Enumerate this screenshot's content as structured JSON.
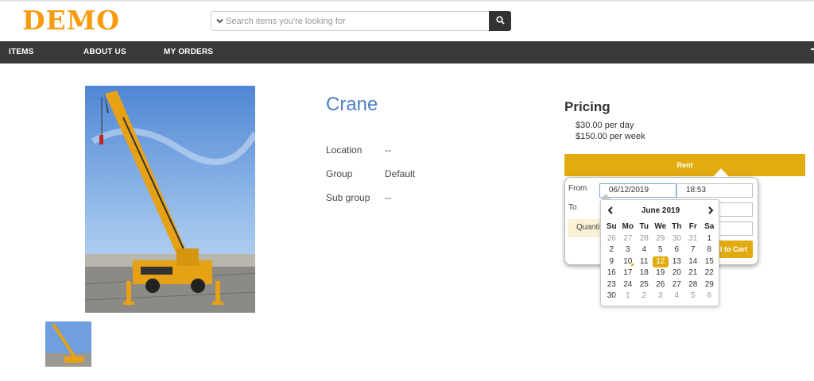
{
  "header": {
    "logo": "DEMO",
    "search_placeholder": "Search items you're looking for",
    "search_icon": "search-icon"
  },
  "nav": {
    "items": [
      {
        "label": "ITEMS"
      },
      {
        "label": "ABOUT US"
      },
      {
        "label": "MY ORDERS"
      }
    ]
  },
  "product": {
    "title": "Crane",
    "details": [
      {
        "label": "Location",
        "value": "--"
      },
      {
        "label": "Group",
        "value": "Default"
      },
      {
        "label": "Sub group",
        "value": "--"
      }
    ]
  },
  "pricing": {
    "title": "Pricing",
    "lines": [
      "$30.00 per day",
      "$150.00 per week"
    ],
    "rent_label": "Rent",
    "from_label": "From",
    "to_label": "To",
    "from_date": "06/12/2019",
    "from_time": "18:53",
    "to_date": "",
    "to_time": "",
    "quantity_label": "Quantity",
    "add_to_cart_label": "Add to Cart"
  },
  "datepicker": {
    "month_title": "June 2019",
    "weekdays": [
      "Su",
      "Mo",
      "Tu",
      "We",
      "Th",
      "Fr",
      "Sa"
    ],
    "weeks": [
      [
        {
          "d": "26",
          "m": true
        },
        {
          "d": "27",
          "m": true
        },
        {
          "d": "28",
          "m": true
        },
        {
          "d": "29",
          "m": true
        },
        {
          "d": "30",
          "m": true
        },
        {
          "d": "31",
          "m": true
        },
        {
          "d": "1"
        }
      ],
      [
        {
          "d": "2"
        },
        {
          "d": "3"
        },
        {
          "d": "4"
        },
        {
          "d": "5"
        },
        {
          "d": "6"
        },
        {
          "d": "7"
        },
        {
          "d": "8"
        }
      ],
      [
        {
          "d": "9"
        },
        {
          "d": "10",
          "today": true
        },
        {
          "d": "11"
        },
        {
          "d": "12",
          "sel": true
        },
        {
          "d": "13"
        },
        {
          "d": "14"
        },
        {
          "d": "15"
        }
      ],
      [
        {
          "d": "16"
        },
        {
          "d": "17"
        },
        {
          "d": "18"
        },
        {
          "d": "19"
        },
        {
          "d": "20"
        },
        {
          "d": "21"
        },
        {
          "d": "22"
        }
      ],
      [
        {
          "d": "23"
        },
        {
          "d": "24"
        },
        {
          "d": "25"
        },
        {
          "d": "26"
        },
        {
          "d": "27"
        },
        {
          "d": "28"
        },
        {
          "d": "29"
        }
      ],
      [
        {
          "d": "30"
        },
        {
          "d": "1",
          "m": true
        },
        {
          "d": "2",
          "m": true
        },
        {
          "d": "3",
          "m": true
        },
        {
          "d": "4",
          "m": true
        },
        {
          "d": "5",
          "m": true
        },
        {
          "d": "6",
          "m": true
        }
      ]
    ]
  },
  "colors": {
    "brand_orange": "#f79a0e",
    "accent_gold": "#e2ac11",
    "nav_bg": "#3a3a3a",
    "title_blue": "#4a7fc1"
  }
}
